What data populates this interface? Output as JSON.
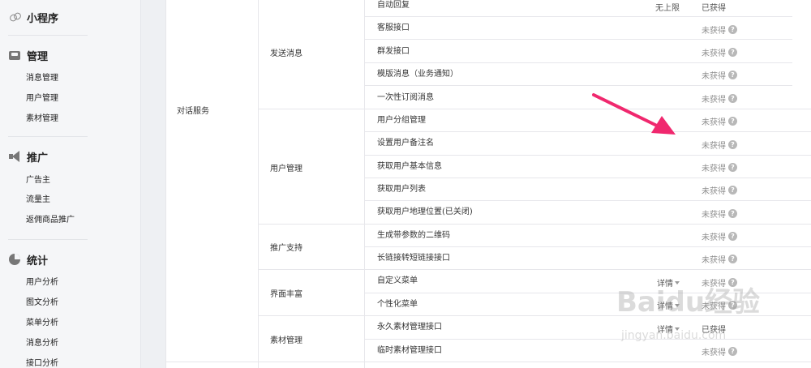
{
  "sidebar": {
    "sections": [
      {
        "title": "小程序",
        "icon": "link-icon",
        "items": []
      },
      {
        "title": "管理",
        "icon": "inbox-icon",
        "items": [
          "消息管理",
          "用户管理",
          "素材管理"
        ]
      },
      {
        "title": "推广",
        "icon": "megaphone-icon",
        "items": [
          "广告主",
          "流量主",
          "返佣商品推广"
        ]
      },
      {
        "title": "统计",
        "icon": "pie-chart-icon",
        "items": [
          "用户分析",
          "图文分析",
          "菜单分析",
          "消息分析",
          "接口分析"
        ]
      }
    ]
  },
  "table": {
    "service_group": "对话服务",
    "categories": [
      "发送消息",
      "用户管理",
      "推广支持",
      "界面丰富",
      "素材管理"
    ],
    "rows": [
      {
        "name": "自动回复",
        "limit": "无上限",
        "status": "已获得",
        "detail": ""
      },
      {
        "name": "客服接口",
        "limit": "",
        "status": "未获得",
        "detail": ""
      },
      {
        "name": "群发接口",
        "limit": "",
        "status": "未获得",
        "detail": ""
      },
      {
        "name": "模版消息（业务通知）",
        "limit": "",
        "status": "未获得",
        "detail": ""
      },
      {
        "name": "一次性订阅消息",
        "limit": "",
        "status": "未获得",
        "detail": ""
      },
      {
        "name": "用户分组管理",
        "limit": "",
        "status": "未获得",
        "detail": ""
      },
      {
        "name": "设置用户备注名",
        "limit": "",
        "status": "未获得",
        "detail": ""
      },
      {
        "name": "获取用户基本信息",
        "limit": "",
        "status": "未获得",
        "detail": ""
      },
      {
        "name": "获取用户列表",
        "limit": "",
        "status": "未获得",
        "detail": ""
      },
      {
        "name": "获取用户地理位置(已关闭)",
        "limit": "",
        "status": "未获得",
        "detail": ""
      },
      {
        "name": "生成带参数的二维码",
        "limit": "",
        "status": "未获得",
        "detail": ""
      },
      {
        "name": "长链接转短链接接口",
        "limit": "",
        "status": "未获得",
        "detail": ""
      },
      {
        "name": "自定义菜单",
        "limit": "",
        "status": "未获得",
        "detail": "详情"
      },
      {
        "name": "个性化菜单",
        "limit": "",
        "status": "未获得",
        "detail": "详情"
      },
      {
        "name": "永久素材管理接口",
        "limit": "",
        "status": "已获得",
        "detail": "详情"
      },
      {
        "name": "临时素材管理接口",
        "limit": "",
        "status": "未获得",
        "detail": ""
      }
    ],
    "help_glyph": "?"
  },
  "annotation": {
    "color": "#f0286e"
  },
  "watermark": {
    "brand": "Baidu经验",
    "url": "jingyan.baidu.com"
  }
}
